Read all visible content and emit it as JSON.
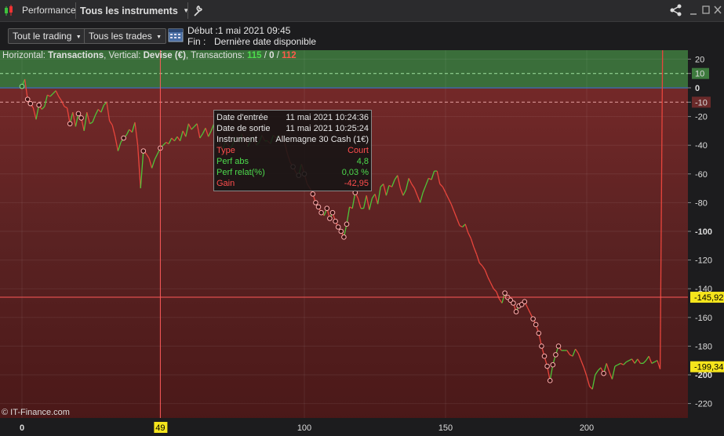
{
  "titlebar": {
    "app_label": "Performance",
    "instrument_selector": "Tous les instruments",
    "icons": [
      "candlestick-icon",
      "chevron-down-icon",
      "wrench-icon",
      "share-icon",
      "minimize-icon",
      "maximize-icon",
      "close-icon"
    ]
  },
  "toolbar": {
    "trading_button": "Tout le trading",
    "trades_button": "Tous les trades",
    "start_label": "Début :",
    "start_value": "1 mai 2021 09:45",
    "end_label": "Fin :",
    "end_value": "Dernière date disponible"
  },
  "header": {
    "prefix": "Horizontal: ",
    "horizontal": "Transactions",
    "vertical_prefix": ", Vertical: ",
    "vertical": "Devise (€)",
    "tx_prefix": ", Transactions: ",
    "tx_total": "115",
    "slash1": " / ",
    "tx_zero": "0",
    "slash2": " / ",
    "tx_losing": "112"
  },
  "tooltip": {
    "rows": [
      {
        "key": "Date d'entrée",
        "value": "11 mai 2021 10:24:36",
        "color": "#e6e6e6"
      },
      {
        "key": "Date de sortie",
        "value": "11 mai 2021 10:25:24",
        "color": "#e6e6e6"
      },
      {
        "key": "Instrument",
        "value": "Allemagne 30 Cash (1€)",
        "color": "#e6e6e6"
      },
      {
        "key": "Type",
        "value": "Court",
        "color": "#ff4d4d"
      },
      {
        "key": "Perf abs",
        "value": "4,8",
        "color": "#4ddc4d"
      },
      {
        "key": "Perf relat(%)",
        "value": "0,03 %",
        "color": "#4ddc4d"
      },
      {
        "key": "Gain",
        "value": "-42,95",
        "color": "#ff4d4d"
      }
    ]
  },
  "watermark": "© IT-Finance.com",
  "cursor": {
    "x_label": "49",
    "y_label": "-145,92"
  },
  "last_value_label": "-199,34",
  "colors": {
    "up": "#4fc53a",
    "down": "#e8453c",
    "positive_zone": "#3d7a3d",
    "axis_highlight": "#f5e51c"
  },
  "chart_data": {
    "type": "line",
    "x_ticks": [
      "0",
      "100",
      "150",
      "200"
    ],
    "y_ticks": [
      "20",
      "10",
      "0",
      "-10",
      "-20",
      "-40",
      "-60",
      "-80",
      "-100",
      "-120",
      "-140",
      "-160",
      "-180",
      "-200",
      "-220"
    ],
    "xlim": [
      -7,
      237
    ],
    "ylim": [
      -232,
      24
    ],
    "threshold_upper": 10,
    "threshold_lower": -10,
    "x": [
      0,
      1,
      2,
      3,
      4,
      5,
      6,
      7,
      8,
      9,
      10,
      11,
      12,
      13,
      14,
      15,
      16,
      17,
      18,
      19,
      20,
      21,
      22,
      23,
      24,
      25,
      26,
      27,
      28,
      29,
      30,
      31,
      32,
      33,
      34,
      35,
      36,
      37,
      38,
      39,
      40,
      41,
      42,
      43,
      44,
      45,
      46,
      47,
      48,
      49,
      50,
      51,
      52,
      53,
      54,
      55,
      56,
      57,
      58,
      59,
      60,
      61,
      62,
      63,
      64,
      65,
      66,
      67,
      68,
      69,
      70,
      71,
      72,
      73,
      74,
      75,
      76,
      77,
      78,
      79,
      80,
      81,
      82,
      83,
      84,
      85,
      86,
      87,
      88,
      89,
      90,
      91,
      92,
      93,
      94,
      95,
      96,
      97,
      98,
      99,
      100,
      101,
      102,
      103,
      104,
      105,
      106,
      107,
      108,
      109,
      110,
      111,
      112,
      113,
      114,
      115,
      116,
      117,
      118,
      119,
      120,
      121,
      122,
      123,
      124,
      125,
      126,
      127,
      128,
      129,
      130,
      131,
      132,
      133,
      134,
      135,
      136,
      137,
      138,
      139,
      140,
      141,
      142,
      143,
      144,
      145,
      146,
      147,
      148,
      149,
      150,
      151,
      152,
      153,
      154,
      155,
      156,
      157,
      158,
      159,
      160,
      161,
      162,
      163,
      164,
      165,
      166,
      167,
      168,
      169,
      170,
      171,
      172,
      173,
      174,
      175,
      176,
      177,
      178,
      179,
      180,
      181,
      182,
      183,
      184,
      185,
      186,
      187,
      188,
      189,
      190,
      191,
      192,
      193,
      194,
      195,
      196,
      197,
      198,
      199,
      200,
      201,
      202,
      203,
      204,
      205,
      206,
      207,
      208,
      209,
      210,
      211,
      212,
      213,
      214,
      215,
      216,
      217,
      218,
      219,
      220,
      221,
      222,
      223,
      224,
      225,
      226,
      227,
      228
    ],
    "y": [
      1,
      6,
      -8,
      -11,
      -14,
      -22,
      -12,
      -15,
      -13,
      -5,
      -6,
      -4,
      -2,
      -6,
      -9,
      -13,
      -14,
      -25,
      -17,
      -27,
      -18,
      -21,
      -30,
      -17,
      -25,
      -24,
      -19,
      -15,
      -17,
      -12,
      -10,
      -23,
      -26,
      -34,
      -44,
      -38,
      -35,
      -33,
      -29,
      -31,
      -24,
      -40,
      -70,
      -44,
      -46,
      -49,
      -56,
      -50,
      -46,
      -42,
      -40,
      -38,
      -39,
      -35,
      -37,
      -34,
      -37,
      -30,
      -34,
      -25,
      -29,
      -27,
      -25,
      -35,
      -32,
      -28,
      -34,
      -30,
      -25,
      -35,
      -37,
      -43,
      -38,
      -40,
      -42,
      -38,
      -34,
      -38,
      -32,
      -36,
      -41,
      -37,
      -34,
      -40,
      -38,
      -33,
      -37,
      -37,
      -39,
      -33,
      -35,
      -33,
      -35,
      -38,
      -46,
      -52,
      -55,
      -59,
      -61,
      -53,
      -60,
      -67,
      -70,
      -74,
      -80,
      -83,
      -87,
      -89,
      -84,
      -91,
      -87,
      -93,
      -97,
      -100,
      -104,
      -95,
      -83,
      -84,
      -73,
      -77,
      -84,
      -84,
      -75,
      -85,
      -77,
      -74,
      -81,
      -69,
      -67,
      -75,
      -68,
      -69,
      -64,
      -61,
      -70,
      -75,
      -71,
      -63,
      -67,
      -70,
      -75,
      -80,
      -73,
      -68,
      -63,
      -64,
      -58,
      -58,
      -67,
      -69,
      -73,
      -77,
      -81,
      -86,
      -91,
      -96,
      -97,
      -95,
      -101,
      -105,
      -111,
      -116,
      -122,
      -124,
      -127,
      -132,
      -136,
      -140,
      -142,
      -147,
      -150,
      -143,
      -146,
      -148,
      -150,
      -156,
      -152,
      -151,
      -149,
      -153,
      -157,
      -161,
      -165,
      -171,
      -180,
      -187,
      -194,
      -204,
      -193,
      -186,
      -180,
      -183,
      -183,
      -183,
      -186,
      -187,
      -182,
      -185,
      -190,
      -195,
      -201,
      -208,
      -210,
      -200,
      -197,
      -195,
      -199,
      -192,
      -198,
      -203,
      -194,
      -193,
      -192,
      -193,
      -191,
      -190,
      -189,
      -192,
      -189,
      -192,
      -192,
      -190,
      -187,
      -192,
      -191,
      -190,
      -196
    ],
    "markers_x": [
      0,
      2,
      3,
      6,
      17,
      20,
      21,
      36,
      43,
      49,
      96,
      98,
      100,
      103,
      104,
      105,
      106,
      108,
      109,
      110,
      111,
      112,
      113,
      114,
      115,
      118,
      171,
      172,
      173,
      174,
      175,
      176,
      177,
      178,
      181,
      182,
      183,
      184,
      185,
      186,
      187,
      188,
      189,
      190,
      206
    ],
    "marker_hollow_green_x": [
      0
    ]
  }
}
